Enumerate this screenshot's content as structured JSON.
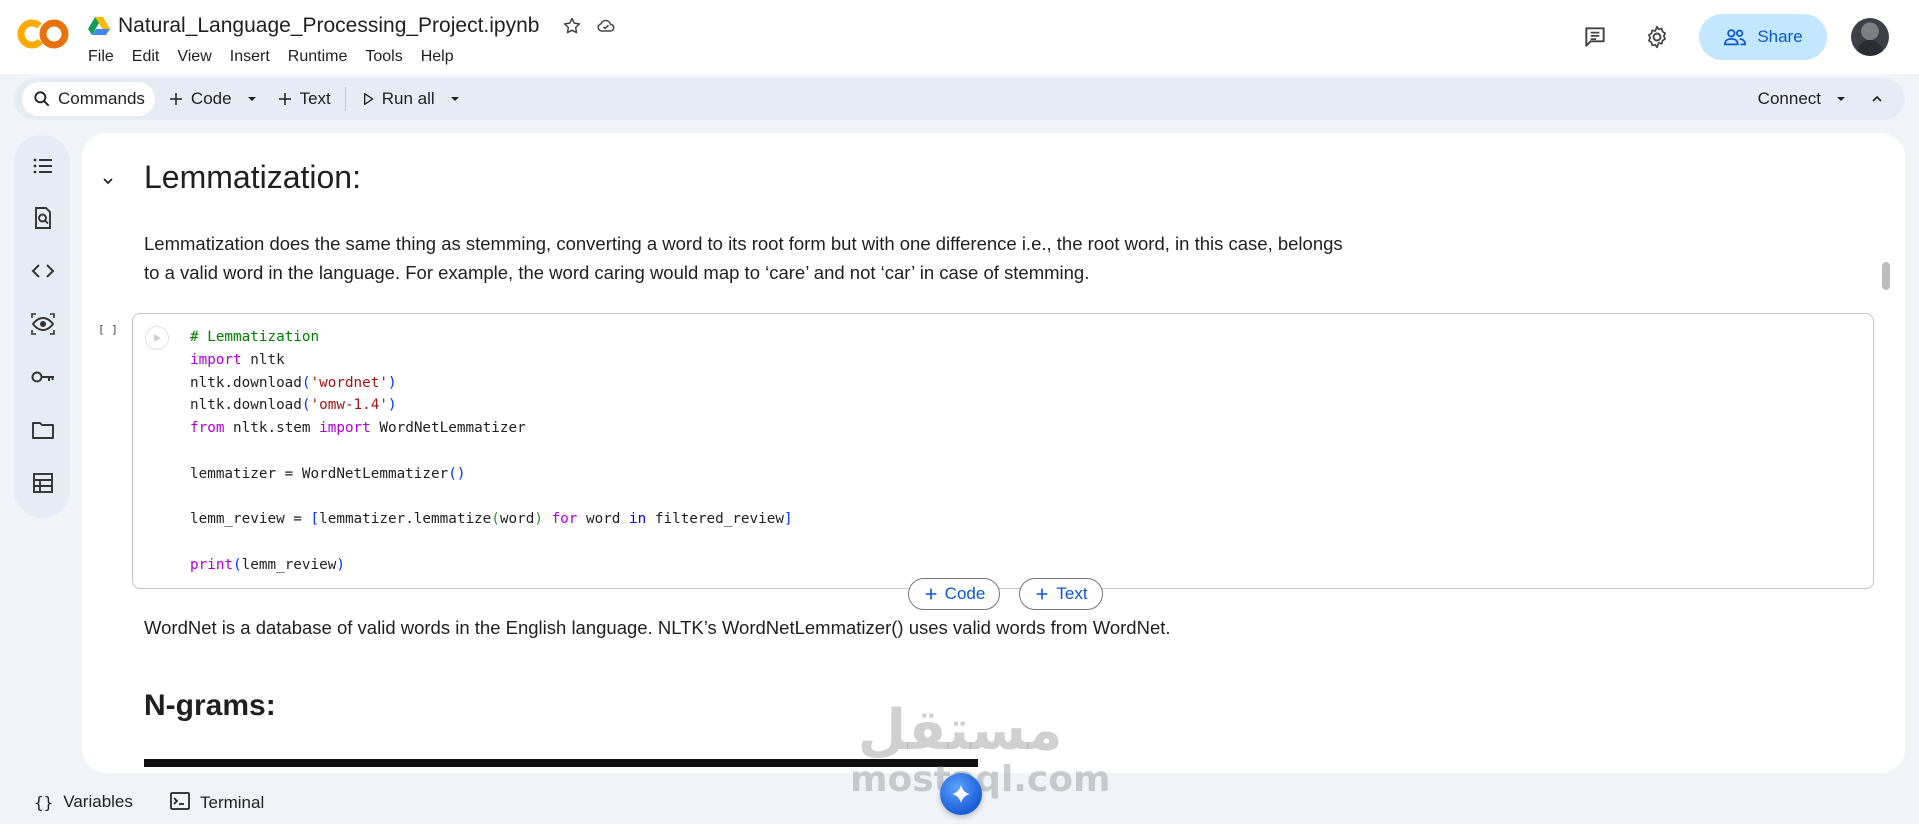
{
  "app": {
    "logo_text": "CO",
    "notebook_title": "Natural_Language_Processing_Project.ipynb"
  },
  "menu": [
    "File",
    "Edit",
    "View",
    "Insert",
    "Runtime",
    "Tools",
    "Help"
  ],
  "header": {
    "share_label": "Share"
  },
  "toolbar": {
    "commands_label": "Commands",
    "code_label": "Code",
    "text_label": "Text",
    "run_all_label": "Run all",
    "connect_label": "Connect"
  },
  "rail_icons": [
    "table-of-contents-icon",
    "find-replace-icon",
    "code-snippets-icon",
    "secrets-eye-icon",
    "key-icon",
    "files-folder-icon",
    "data-table-icon"
  ],
  "content": {
    "lemma_heading": "Lemmatization:",
    "lemma_paragraph": "Lemmatization does the same thing as stemming, converting a word to its root form but with one difference i.e., the root word, in this case, belongs to a valid word in the language. For example, the word caring would map to ‘care’ and not ‘car’ in case of stemming.",
    "exec_count": "[ ]",
    "code_lines": [
      [
        {
          "t": "# Lemmatization",
          "c": "com"
        }
      ],
      [
        {
          "t": "import",
          "c": "kw"
        },
        {
          "t": " nltk",
          "c": ""
        }
      ],
      [
        {
          "t": "nltk.download",
          "c": ""
        },
        {
          "t": "(",
          "c": "par"
        },
        {
          "t": "'wordnet'",
          "c": "str"
        },
        {
          "t": ")",
          "c": "par"
        }
      ],
      [
        {
          "t": "nltk.download",
          "c": ""
        },
        {
          "t": "(",
          "c": "par"
        },
        {
          "t": "'omw-1.4'",
          "c": "str"
        },
        {
          "t": ")",
          "c": "par"
        }
      ],
      [
        {
          "t": "from",
          "c": "kw"
        },
        {
          "t": " nltk.stem ",
          "c": ""
        },
        {
          "t": "import",
          "c": "kw"
        },
        {
          "t": " WordNetLemmatizer",
          "c": ""
        }
      ],
      [
        {
          "t": "",
          "c": ""
        }
      ],
      [
        {
          "t": "lemmatizer = WordNetLemmatizer",
          "c": ""
        },
        {
          "t": "()",
          "c": "par"
        }
      ],
      [
        {
          "t": "",
          "c": ""
        }
      ],
      [
        {
          "t": "lemm_review = ",
          "c": ""
        },
        {
          "t": "[",
          "c": "par"
        },
        {
          "t": "lemmatizer.lemmatize",
          "c": ""
        },
        {
          "t": "(",
          "c": "par2"
        },
        {
          "t": "word",
          "c": ""
        },
        {
          "t": ")",
          "c": "par2"
        },
        {
          "t": " ",
          "c": ""
        },
        {
          "t": "for",
          "c": "kw"
        },
        {
          "t": " word ",
          "c": ""
        },
        {
          "t": "in",
          "c": "kw2"
        },
        {
          "t": " filtered_review",
          "c": ""
        },
        {
          "t": "]",
          "c": "par"
        }
      ],
      [
        {
          "t": "",
          "c": ""
        }
      ],
      [
        {
          "t": "print",
          "c": "kw"
        },
        {
          "t": "(",
          "c": "par"
        },
        {
          "t": "lemm_review",
          "c": ""
        },
        {
          "t": ")",
          "c": "par"
        }
      ]
    ],
    "add_code_label": "Code",
    "add_text_label": "Text",
    "wordnet_paragraph": "WordNet is a database of valid words in the English language. NLTK’s WordNetLemmatizer() uses valid words from WordNet.",
    "ngrams_heading": "N-grams:"
  },
  "statusbar": {
    "variables_label": "Variables",
    "terminal_label": "Terminal"
  },
  "watermark": {
    "arabic": "مستقل",
    "latin": "mostaql.com"
  },
  "colors": {
    "accent": "#0b57d0",
    "share_bg": "#c2e7ff",
    "panel_bg": "#f0f4f9",
    "toolbar_bg": "#e6ecf4",
    "logo_orange": "#f9ab00",
    "logo_dark_orange": "#e8710a"
  }
}
